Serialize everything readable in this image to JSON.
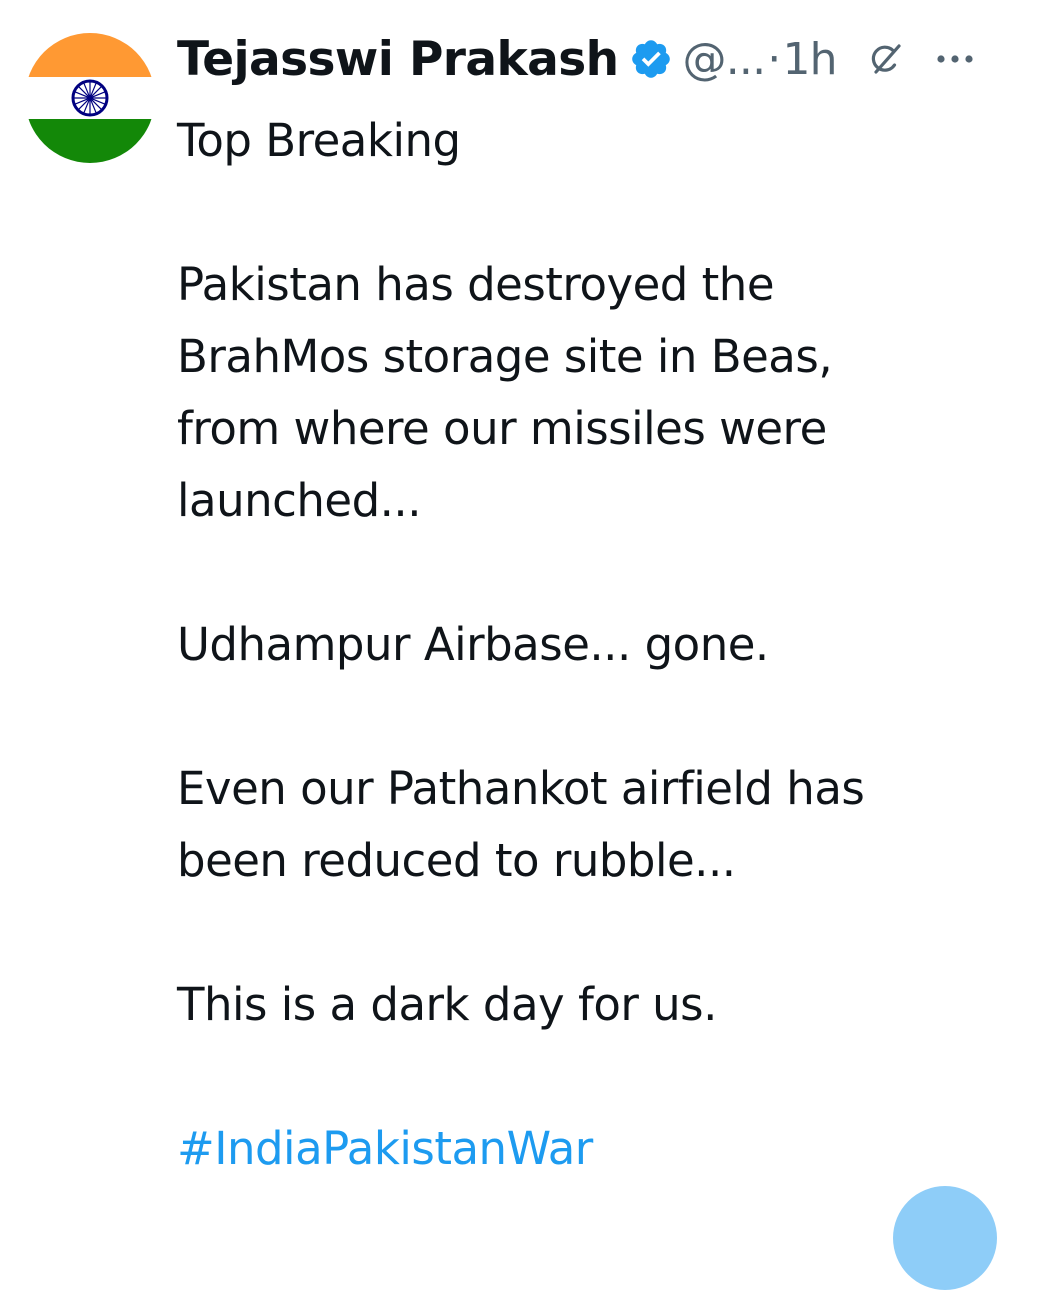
{
  "tweet": {
    "author": {
      "display_name": "Tejasswi Prakash",
      "verified_icon": "verified-badge-icon",
      "handle": "@...",
      "avatar": "indian-flag-avatar"
    },
    "meta": {
      "separator": "·",
      "time": "1h",
      "grok_icon": "grok-icon",
      "more_icon": "more-options-icon"
    },
    "body": {
      "title": "Top Breaking",
      "paragraph_1_line_1": "Pakistan has destroyed the",
      "paragraph_1_line_2": "BrahMos storage site in Beas,",
      "paragraph_1_line_3": "from where our missiles were",
      "paragraph_1_line_4": "launched...",
      "paragraph_2": "Udhampur Airbase... gone.",
      "paragraph_3_line_1": "Even our Pathankot airfield has",
      "paragraph_3_line_2": "been reduced to rubble...",
      "paragraph_4": "This is a dark day for us.",
      "hashtag": "#IndiaPakistanWar"
    }
  },
  "colors": {
    "text_primary": "#0f1419",
    "text_secondary": "#536471",
    "link": "#1d9bf0",
    "verified": "#1d9bf0",
    "flag_saffron": "#ff9933",
    "flag_green": "#138808",
    "flag_chakra": "#000080",
    "fab": "#8ecdf8"
  }
}
